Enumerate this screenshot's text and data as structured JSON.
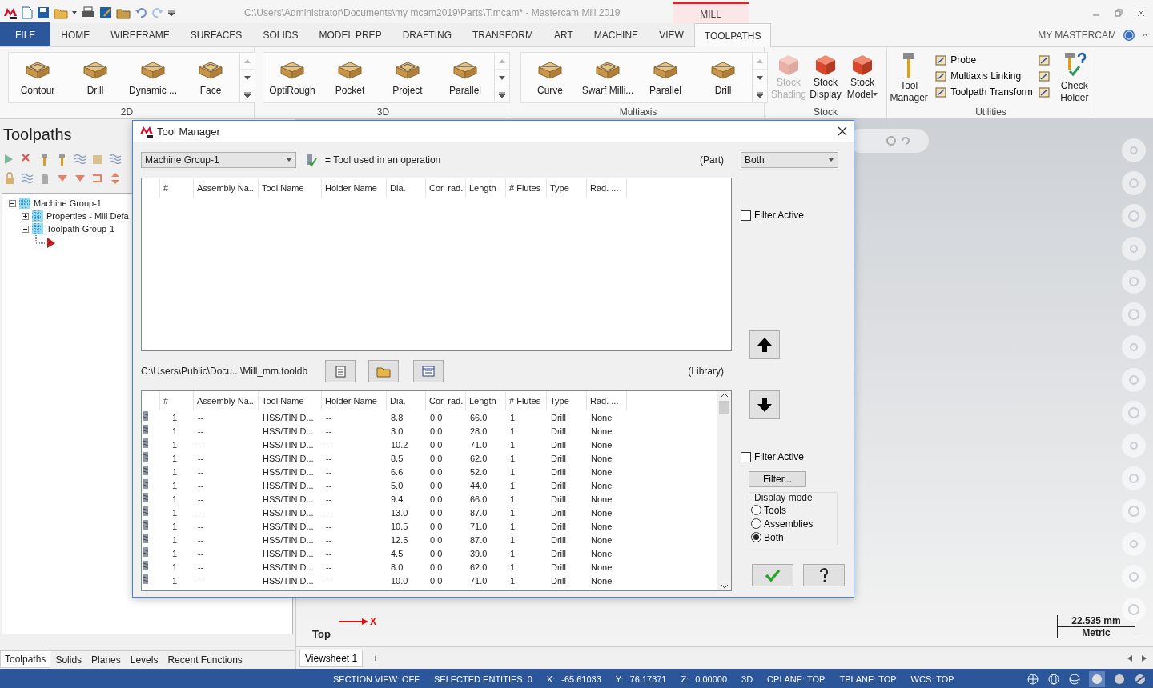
{
  "title_bar": {
    "title": "C:\\Users\\Administrator\\Documents\\my mcam2019\\Parts\\T.mcam* - Mastercam Mill 2019",
    "context_tab": "MILL"
  },
  "ribbon_tabs": [
    {
      "label": "FILE",
      "kind": "file",
      "selected": false
    },
    {
      "label": "HOME",
      "kind": "tab",
      "selected": false
    },
    {
      "label": "WIREFRAME",
      "kind": "tab",
      "selected": false
    },
    {
      "label": "SURFACES",
      "kind": "tab",
      "selected": false
    },
    {
      "label": "SOLIDS",
      "kind": "tab",
      "selected": false
    },
    {
      "label": "MODEL PREP",
      "kind": "tab",
      "selected": false
    },
    {
      "label": "DRAFTING",
      "kind": "tab",
      "selected": false
    },
    {
      "label": "TRANSFORM",
      "kind": "tab",
      "selected": false
    },
    {
      "label": "ART",
      "kind": "tab",
      "selected": false
    },
    {
      "label": "MACHINE",
      "kind": "tab",
      "selected": false
    },
    {
      "label": "VIEW",
      "kind": "tab",
      "selected": false
    },
    {
      "label": "TOOLPATHS",
      "kind": "tab",
      "selected": true
    }
  ],
  "account": "MY MASTERCAM",
  "ribbon_groups": [
    {
      "label": "2D",
      "kind": "gallery",
      "items": [
        {
          "label": "Contour"
        },
        {
          "label": "Drill"
        },
        {
          "label": "Dynamic ..."
        },
        {
          "label": "Face"
        }
      ]
    },
    {
      "label": "3D",
      "kind": "gallery",
      "items": [
        {
          "label": "OptiRough"
        },
        {
          "label": "Pocket"
        },
        {
          "label": "Project"
        },
        {
          "label": "Parallel"
        }
      ]
    },
    {
      "label": "Multiaxis",
      "kind": "gallery",
      "items": [
        {
          "label": "Curve"
        },
        {
          "label": "Swarf Milli..."
        },
        {
          "label": "Parallel"
        },
        {
          "label": "Drill"
        }
      ]
    },
    {
      "label": "Stock",
      "kind": "buttons",
      "items": [
        {
          "label": "Stock Shading",
          "disabled": true,
          "dropdown": false
        },
        {
          "label": "Stock Display",
          "disabled": false,
          "dropdown": false
        },
        {
          "label": "Stock Model",
          "disabled": false,
          "dropdown": true
        }
      ]
    },
    {
      "label": "Utilities",
      "kind": "utilities",
      "large": "Tool Manager",
      "small": [
        "Probe",
        "Multiaxis Linking",
        "Toolpath Transform"
      ],
      "end": "Check Holder"
    }
  ],
  "left_panel": {
    "title": "Toolpaths",
    "tree": [
      {
        "label": "Machine Group-1",
        "expanded": true,
        "children": [
          {
            "label": "Properties - Mill Defa",
            "expanded": false
          },
          {
            "label": "Toolpath Group-1",
            "expanded": true
          }
        ]
      }
    ],
    "tabs": [
      {
        "label": "Toolpaths",
        "selected": true
      },
      {
        "label": "Solids",
        "selected": false
      },
      {
        "label": "Planes",
        "selected": false
      },
      {
        "label": "Levels",
        "selected": false
      },
      {
        "label": "Recent Functions",
        "selected": false
      }
    ]
  },
  "viewport": {
    "view_label": "Top",
    "axis_label": "X",
    "scale": {
      "value": "22.535 mm",
      "unit": "Metric"
    },
    "sheet_tabs": [
      {
        "label": "Viewsheet 1",
        "selected": true
      }
    ],
    "add_tab": "+"
  },
  "dialog": {
    "title": "Tool Manager",
    "machine_group": "Machine Group-1",
    "legend": "= Tool used in an operation",
    "part_label": "(Part)",
    "part_filter": "Both",
    "part_columns": [
      "#",
      "Assembly Na...",
      "Tool Name",
      "Holder Name",
      "Dia.",
      "Cor. rad.",
      "Length",
      "# Flutes",
      "Type",
      "Rad. ..."
    ],
    "part_filter_active": {
      "label": "Filter Active",
      "checked": false
    },
    "library_path": "C:\\Users\\Public\\Docu...\\Mill_mm.tooldb",
    "library_label": "(Library)",
    "library_columns": [
      "#",
      "Assembly Na...",
      "Tool Name",
      "Holder Name",
      "Dia.",
      "Cor. rad.",
      "Length",
      "# Flutes",
      "Type",
      "Rad. ..."
    ],
    "library_rows": [
      [
        "1",
        "--",
        "HSS/TIN D...",
        "--",
        "8.8",
        "0.0",
        "66.0",
        "1",
        "Drill",
        "None"
      ],
      [
        "1",
        "--",
        "HSS/TIN D...",
        "--",
        "3.0",
        "0.0",
        "28.0",
        "1",
        "Drill",
        "None"
      ],
      [
        "1",
        "--",
        "HSS/TIN D...",
        "--",
        "10.2",
        "0.0",
        "71.0",
        "1",
        "Drill",
        "None"
      ],
      [
        "1",
        "--",
        "HSS/TIN D...",
        "--",
        "8.5",
        "0.0",
        "62.0",
        "1",
        "Drill",
        "None"
      ],
      [
        "1",
        "--",
        "HSS/TIN D...",
        "--",
        "6.6",
        "0.0",
        "52.0",
        "1",
        "Drill",
        "None"
      ],
      [
        "1",
        "--",
        "HSS/TIN D...",
        "--",
        "5.0",
        "0.0",
        "44.0",
        "1",
        "Drill",
        "None"
      ],
      [
        "1",
        "--",
        "HSS/TIN D...",
        "--",
        "9.4",
        "0.0",
        "66.0",
        "1",
        "Drill",
        "None"
      ],
      [
        "1",
        "--",
        "HSS/TIN D...",
        "--",
        "13.0",
        "0.0",
        "87.0",
        "1",
        "Drill",
        "None"
      ],
      [
        "1",
        "--",
        "HSS/TIN D...",
        "--",
        "10.5",
        "0.0",
        "71.0",
        "1",
        "Drill",
        "None"
      ],
      [
        "1",
        "--",
        "HSS/TIN D...",
        "--",
        "12.5",
        "0.0",
        "87.0",
        "1",
        "Drill",
        "None"
      ],
      [
        "1",
        "--",
        "HSS/TIN D...",
        "--",
        "4.5",
        "0.0",
        "39.0",
        "1",
        "Drill",
        "None"
      ],
      [
        "1",
        "--",
        "HSS/TIN D...",
        "--",
        "8.0",
        "0.0",
        "62.0",
        "1",
        "Drill",
        "None"
      ],
      [
        "1",
        "--",
        "HSS/TIN D...",
        "--",
        "10.0",
        "0.0",
        "71.0",
        "1",
        "Drill",
        "None"
      ]
    ],
    "library_filter_active": {
      "label": "Filter Active",
      "checked": false
    },
    "filter_button": "Filter...",
    "display_mode": {
      "label": "Display mode",
      "options": [
        {
          "label": "Tools",
          "selected": false
        },
        {
          "label": "Assemblies",
          "selected": false
        },
        {
          "label": "Both",
          "selected": true
        }
      ]
    }
  },
  "status_bar": {
    "items": [
      {
        "text": "SECTION VIEW: OFF",
        "kind": "field"
      },
      {
        "text": "SELECTED ENTITIES: 0",
        "kind": "field"
      },
      {
        "text": "X:",
        "kind": "label"
      },
      {
        "text": "-65.61033",
        "kind": "value"
      },
      {
        "text": "Y:",
        "kind": "label"
      },
      {
        "text": "76.17371",
        "kind": "value"
      },
      {
        "text": "Z:",
        "kind": "label"
      },
      {
        "text": "0.00000",
        "kind": "value"
      },
      {
        "text": "3D",
        "kind": "field"
      },
      {
        "text": "CPLANE: TOP",
        "kind": "field"
      },
      {
        "text": "TPLANE: TOP",
        "kind": "field"
      },
      {
        "text": "WCS: TOP",
        "kind": "field"
      }
    ]
  }
}
